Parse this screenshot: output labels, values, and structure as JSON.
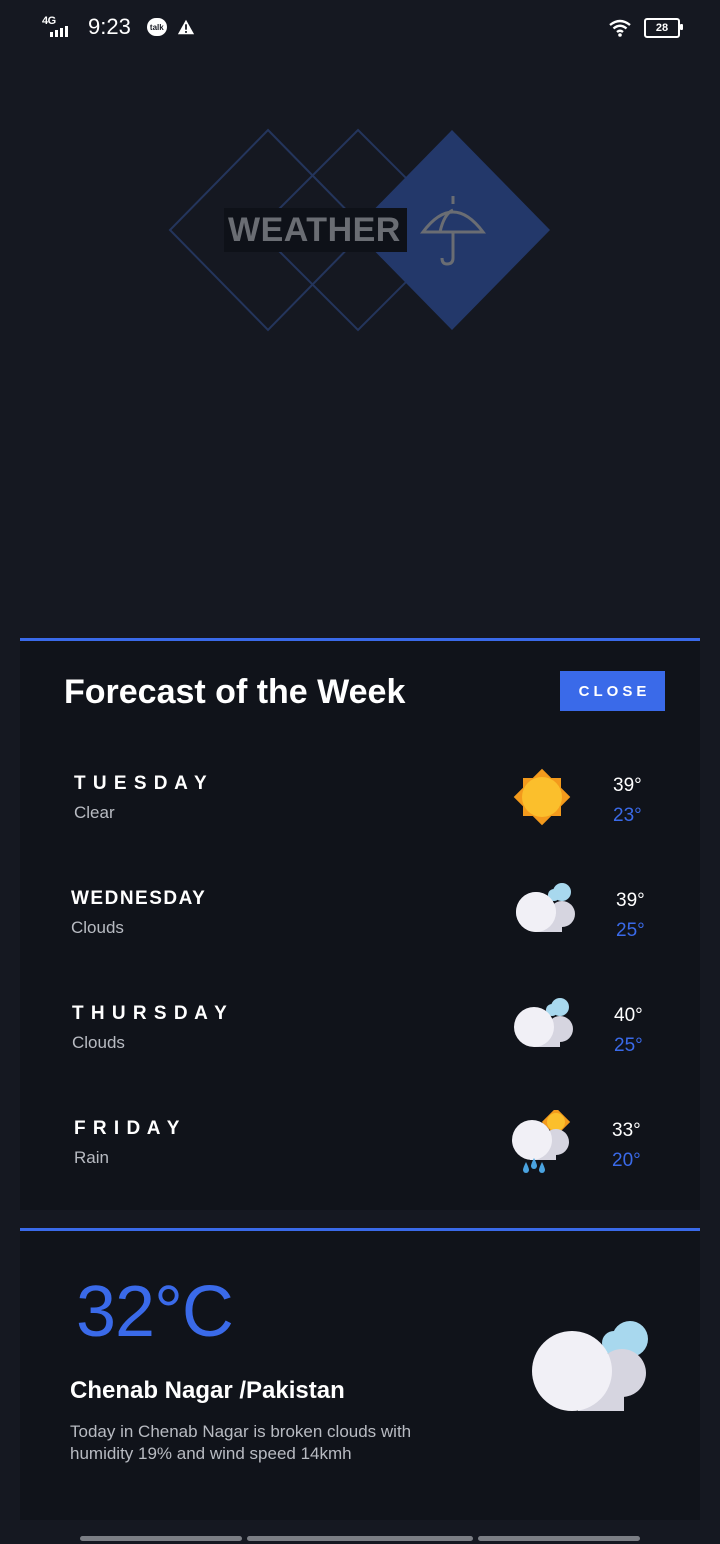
{
  "status_bar": {
    "network": "4G",
    "time": "9:23",
    "talk_label": "talk",
    "battery": "28"
  },
  "logo": {
    "text": "WEATHER",
    "icon": "umbrella-icon"
  },
  "forecast": {
    "title": "Forecast of the Week",
    "close_label": "CLOSE",
    "days": [
      {
        "name": "T U E S D A Y",
        "condition": "Clear",
        "icon": "sun-icon",
        "high": "39°",
        "low": "23°"
      },
      {
        "name": "WEDNESDAY",
        "condition": "Clouds",
        "icon": "clouds-icon",
        "high": "39°",
        "low": "25°"
      },
      {
        "name": "T H U R S D A Y",
        "condition": "Clouds",
        "icon": "clouds-icon",
        "high": "40°",
        "low": "25°"
      },
      {
        "name": "F R I D A Y",
        "condition": "Rain",
        "icon": "rain-icon",
        "high": "33°",
        "low": "20°"
      }
    ]
  },
  "current": {
    "temperature": "32°C",
    "location": "Chenab Nagar /Pakistan",
    "description": "Today in Chenab Nagar is broken clouds with humidity 19% and wind speed 14kmh",
    "icon": "broken-clouds-icon"
  },
  "colors": {
    "background": "#151821",
    "card": "#10131a",
    "accent": "#3a6ae9",
    "muted_text": "#b8bbc2"
  }
}
